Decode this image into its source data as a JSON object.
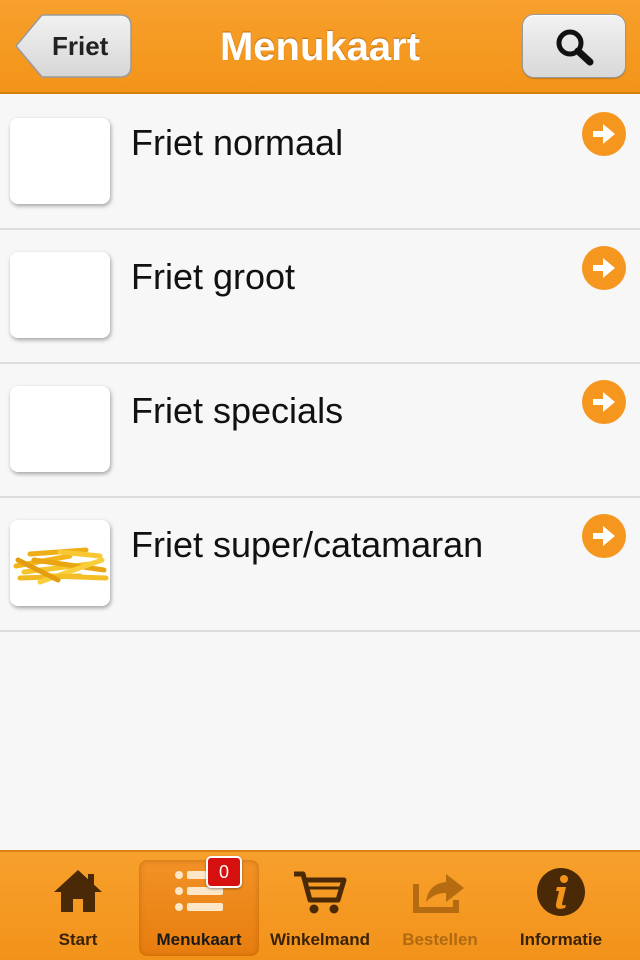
{
  "header": {
    "back_label": "Friet",
    "title": "Menukaart",
    "search_icon": "search-icon"
  },
  "menu_items": [
    {
      "label": "Friet normaal",
      "has_image": false
    },
    {
      "label": "Friet groot",
      "has_image": false
    },
    {
      "label": "Friet specials",
      "has_image": false
    },
    {
      "label": "Friet super/catamaran",
      "has_image": true,
      "image_icon": "fries-image"
    }
  ],
  "tabbar": {
    "tabs": [
      {
        "label": "Start",
        "icon": "home-icon"
      },
      {
        "label": "Menukaart",
        "icon": "list-icon",
        "active": true
      },
      {
        "label": "Winkelmand",
        "icon": "cart-icon"
      },
      {
        "label": "Bestellen",
        "icon": "share-icon",
        "disabled": true
      },
      {
        "label": "Informatie",
        "icon": "info-icon"
      }
    ],
    "cart_count": "0"
  },
  "colors": {
    "accent": "#f5961e",
    "badge": "#d60f0f",
    "background": "#f7f7f7"
  }
}
